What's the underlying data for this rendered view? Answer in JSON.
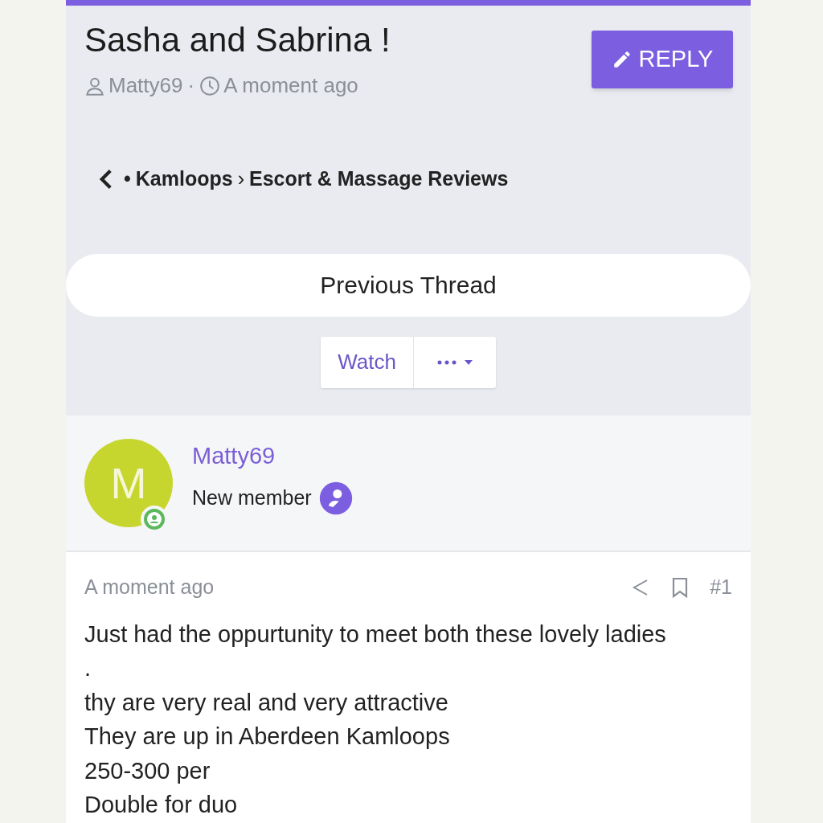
{
  "thread": {
    "title": "Sasha and Sabrina !",
    "author": "Matty69",
    "separator": "·",
    "time": "A moment ago"
  },
  "reply_button": {
    "label": "REPLY"
  },
  "breadcrumb": {
    "bullet": "•",
    "separator": "›",
    "items": [
      "Kamloops",
      "Escort & Massage Reviews"
    ]
  },
  "previous_thread": {
    "label": "Previous Thread"
  },
  "watch_button": {
    "label": "Watch"
  },
  "post": {
    "avatar_letter": "M",
    "online": true,
    "author": "Matty69",
    "role": "New member",
    "time": "A moment ago",
    "number": "#1",
    "lines": [
      "Just had the oppurtunity to meet both these lovely ladies",
      ".",
      "thy are very real and very attractive",
      "They are up in Aberdeen Kamloops",
      "250-300 per",
      "Double for duo"
    ]
  }
}
